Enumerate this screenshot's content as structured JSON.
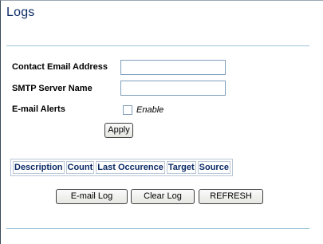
{
  "page": {
    "title": "Logs"
  },
  "form": {
    "contact_email_label": "Contact Email Address",
    "contact_email_value": "",
    "smtp_server_label": "SMTP Server Name",
    "smtp_server_value": "",
    "email_alerts_label": "E-mail Alerts",
    "enable_label": "Enable",
    "enable_checked": false,
    "apply_label": "Apply"
  },
  "log_table": {
    "columns": [
      "Description",
      "Count",
      "Last Occurence",
      "Target",
      "Source"
    ]
  },
  "actions": {
    "email_log_label": "E-mail Log",
    "clear_log_label": "Clear Log",
    "refresh_label": "REFRESH"
  },
  "colors": {
    "title": "#0b2a66",
    "rule": "#9dc5d9",
    "table_header_text": "#0b2a66"
  }
}
